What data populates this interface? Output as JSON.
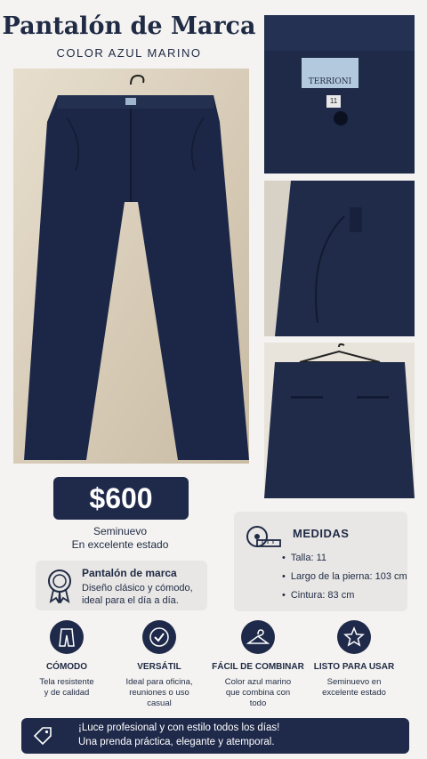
{
  "header": {
    "title": "Pantalón de Marca",
    "subtitle": "COLOR AZUL MARINO"
  },
  "photos": {
    "label_brand": "TERRIONI",
    "label_size": "11"
  },
  "price": {
    "value": "$600",
    "condition_line1": "Seminuevo",
    "condition_line2": "En excelente estado"
  },
  "product_card": {
    "icon": "award-icon",
    "heading": "Pantalón de marca",
    "text_line1": "Diseño clásico y cómodo,",
    "text_line2": "ideal para el día a día."
  },
  "measurements": {
    "icon": "measuring-tape-icon",
    "heading": "MEDIDAS",
    "items": [
      "Talla: 11",
      "Largo de la pierna: 103 cm",
      "Cintura: 83 cm"
    ]
  },
  "features": [
    {
      "icon": "pants-icon",
      "title": "CÓMODO",
      "line1": "Tela resistente",
      "line2": "y de calidad",
      "line3": ""
    },
    {
      "icon": "check-icon",
      "title": "VERSÁTIL",
      "line1": "Ideal para oficina,",
      "line2": "reuniones o uso",
      "line3": "casual"
    },
    {
      "icon": "hanger-icon",
      "title": "FÁCIL DE COMBINAR",
      "line1": "Color azul marino",
      "line2": "que combina con",
      "line3": "todo"
    },
    {
      "icon": "star-icon",
      "title": "LISTO PARA USAR",
      "line1": "Seminuevo en",
      "line2": "excelente estado",
      "line3": ""
    }
  ],
  "banner": {
    "icon": "price-tag-icon",
    "line1": "¡Luce profesional y con estilo todos los días!",
    "line2": "Una prenda práctica, elegante y atemporal."
  },
  "colors": {
    "navy": "#1f2a4a",
    "card_bg": "#e8e7e5",
    "page_bg": "#f4f3f1"
  }
}
